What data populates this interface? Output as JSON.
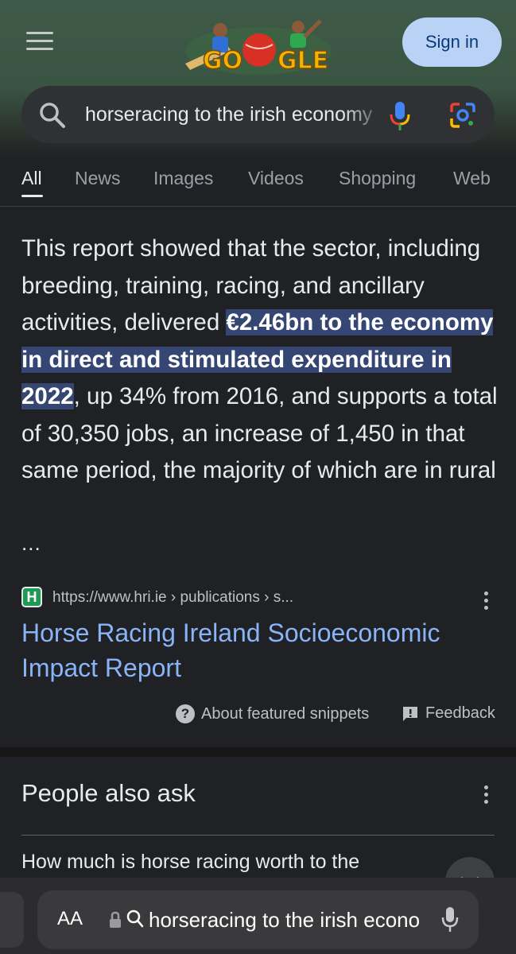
{
  "header": {
    "doodle_text": "GOOGLE",
    "signin_label": "Sign in"
  },
  "search": {
    "query": "horseracing to the irish economy"
  },
  "tabs": [
    {
      "label": "All",
      "active": true
    },
    {
      "label": "News"
    },
    {
      "label": "Images"
    },
    {
      "label": "Videos"
    },
    {
      "label": "Shopping"
    },
    {
      "label": "Web"
    }
  ],
  "snippet": {
    "before": "This report showed that the sector, including breeding, training, racing, and ancillary activities, delivered ",
    "highlight": "€2.46bn to the economy in direct and stimulated expenditure in 2022",
    "after": ", up 34% from 2016, and supports a total of 30,350 jobs, an increase of 1,450 in that same period, the majority of which are in rural",
    "ellipsis": "..."
  },
  "result": {
    "favicon_letter": "H",
    "url": "https://www.hri.ie › publications › s...",
    "title": "Horse Racing Ireland Socioeconomic Impact Report"
  },
  "footer_links": {
    "about": "About featured snippets",
    "feedback": "Feedback"
  },
  "paa": {
    "title": "People also ask",
    "first_question": "How much is horse racing worth to the"
  },
  "browser": {
    "aa_label": "AA",
    "url_text": "horseracing to the irish economy"
  },
  "colors": {
    "background": "#202124",
    "link": "#8ab4f8",
    "highlight": "#364673",
    "signin_bg": "#b9d2f6"
  }
}
